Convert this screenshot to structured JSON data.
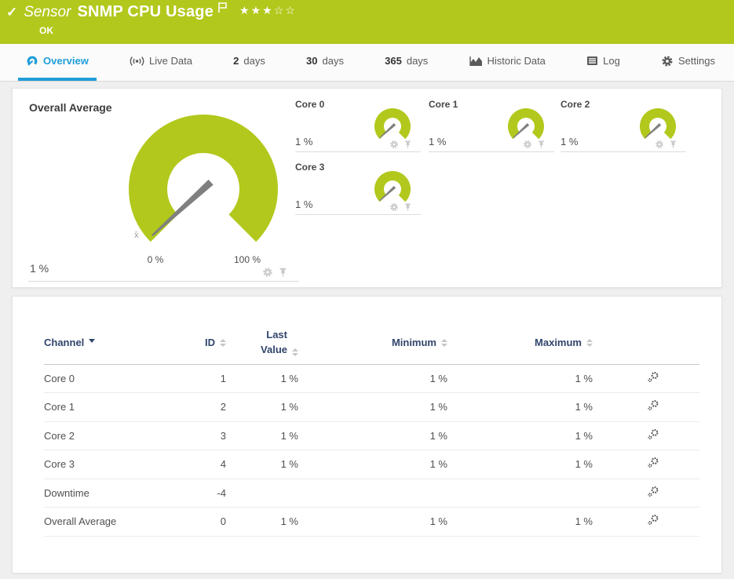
{
  "colors": {
    "brand_green": "#b2c81c",
    "accent_blue": "#1f9dd9",
    "table_header_navy": "#31456b",
    "needle_gray": "#7f7f7f"
  },
  "icons": {
    "check": "✓",
    "star_filled": "★",
    "star_empty": "☆"
  },
  "header": {
    "kind_label": "Sensor",
    "title": "SNMP CPU Usage",
    "status": "OK",
    "rating_filled": 3,
    "rating_total": 5
  },
  "tabs": [
    {
      "label": "Overview",
      "icon": "gauge-icon",
      "active": true
    },
    {
      "label": "Live Data",
      "icon": "live-data-icon"
    },
    {
      "prefix": "2",
      "label": "days"
    },
    {
      "prefix": "30",
      "label": "days"
    },
    {
      "prefix": "365",
      "label": "days"
    },
    {
      "label": "Historic Data",
      "icon": "historic-data-icon"
    },
    {
      "label": "Log",
      "icon": "log-icon"
    },
    {
      "label": "Settings",
      "icon": "settings-gear-icon"
    }
  ],
  "gauges": {
    "overall": {
      "title": "Overall Average",
      "value": "1 %",
      "percent": 1,
      "min_label": "0 %",
      "max_label": "100 %",
      "avg_marker": "x̄"
    },
    "cores": [
      {
        "title": "Core 0",
        "value": "1 %",
        "percent": 1
      },
      {
        "title": "Core 1",
        "value": "1 %",
        "percent": 1
      },
      {
        "title": "Core 2",
        "value": "1 %",
        "percent": 1
      },
      {
        "title": "Core 3",
        "value": "1 %",
        "percent": 1
      }
    ]
  },
  "table": {
    "header": {
      "channel": "Channel",
      "id": "ID",
      "last_value": "Last Value",
      "minimum": "Minimum",
      "maximum": "Maximum"
    },
    "rows": [
      {
        "channel": "Core 0",
        "id": "1",
        "last": "1 %",
        "min": "1 %",
        "max": "1 %"
      },
      {
        "channel": "Core 1",
        "id": "2",
        "last": "1 %",
        "min": "1 %",
        "max": "1 %"
      },
      {
        "channel": "Core 2",
        "id": "3",
        "last": "1 %",
        "min": "1 %",
        "max": "1 %"
      },
      {
        "channel": "Core 3",
        "id": "4",
        "last": "1 %",
        "min": "1 %",
        "max": "1 %"
      },
      {
        "channel": "Downtime",
        "id": "-4",
        "last": "",
        "min": "",
        "max": ""
      },
      {
        "channel": "Overall Average",
        "id": "0",
        "last": "1 %",
        "min": "1 %",
        "max": "1 %"
      }
    ]
  }
}
